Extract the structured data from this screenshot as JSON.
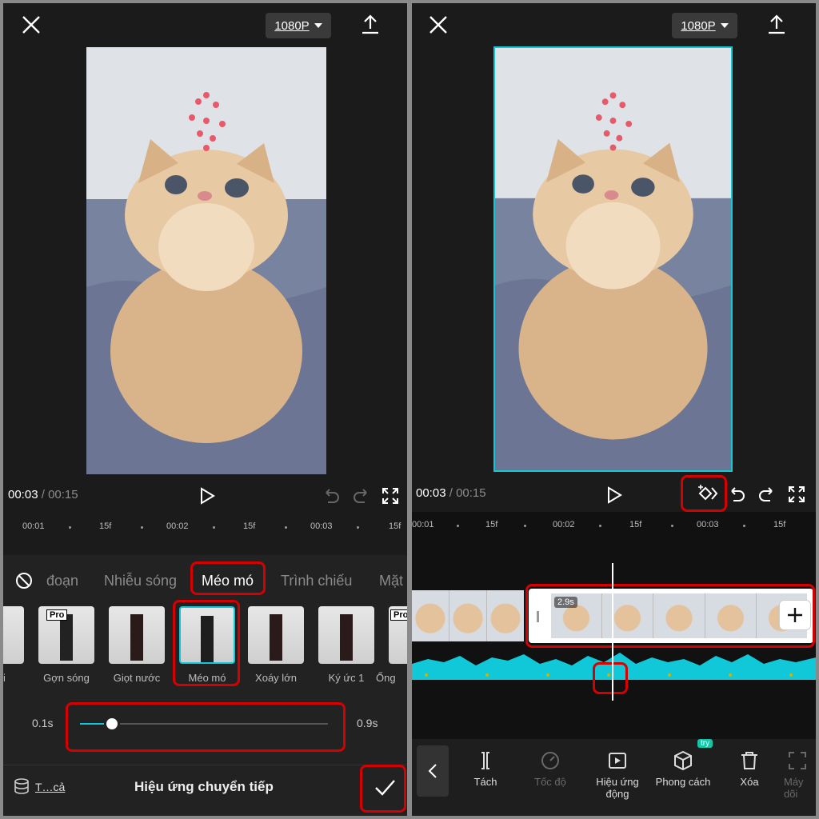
{
  "left": {
    "resolution": "1080P",
    "time_current": "00:03",
    "time_sep": " / ",
    "time_total": "00:15",
    "ruler": [
      "00:01",
      "15f",
      "00:02",
      "15f",
      "00:03",
      "15f"
    ],
    "tabs": [
      "đoạn",
      "Nhiễu sóng",
      "Méo mó",
      "Trình chiếu",
      "Mặt"
    ],
    "active_tab": "Méo mó",
    "thumbs": [
      {
        "label": "ii",
        "pro": false
      },
      {
        "label": "Gợn sóng",
        "pro": true
      },
      {
        "label": "Giọt nước",
        "pro": false
      },
      {
        "label": "Méo mó",
        "pro": false
      },
      {
        "label": "Xoáy lớn",
        "pro": false
      },
      {
        "label": "Ký ức 1",
        "pro": false
      },
      {
        "label": "Ống",
        "pro": true
      }
    ],
    "pro_badge": "Pro",
    "slider": {
      "min_label": "0.1s",
      "max_label": "0.9s",
      "value_fraction": 0.13
    },
    "apply_all": "T…cả",
    "panel_title": "Hiệu ứng chuyển tiếp"
  },
  "right": {
    "resolution": "1080P",
    "time_current": "00:03",
    "time_sep": " / ",
    "time_total": "00:15",
    "ruler": [
      "00:01",
      "15f",
      "00:02",
      "15f",
      "00:03",
      "15f"
    ],
    "clip_duration": "2.9s",
    "try_badge": "try",
    "tools": [
      {
        "label": "Tách",
        "icon": "split-icon",
        "enabled": true
      },
      {
        "label": "Tốc độ",
        "icon": "speed-icon",
        "enabled": false
      },
      {
        "label": "Hiệu ứng động",
        "icon": "play-effect-icon",
        "enabled": true
      },
      {
        "label": "Phong cách",
        "icon": "cube-icon",
        "enabled": true
      },
      {
        "label": "Xóa",
        "icon": "trash-icon",
        "enabled": true
      },
      {
        "label": "Máy dõi",
        "icon": "tracking-icon",
        "enabled": false
      }
    ]
  },
  "colors": {
    "accent": "#10c8d8",
    "highlight": "#d50000",
    "panel_bg": "#1b1b1b"
  }
}
